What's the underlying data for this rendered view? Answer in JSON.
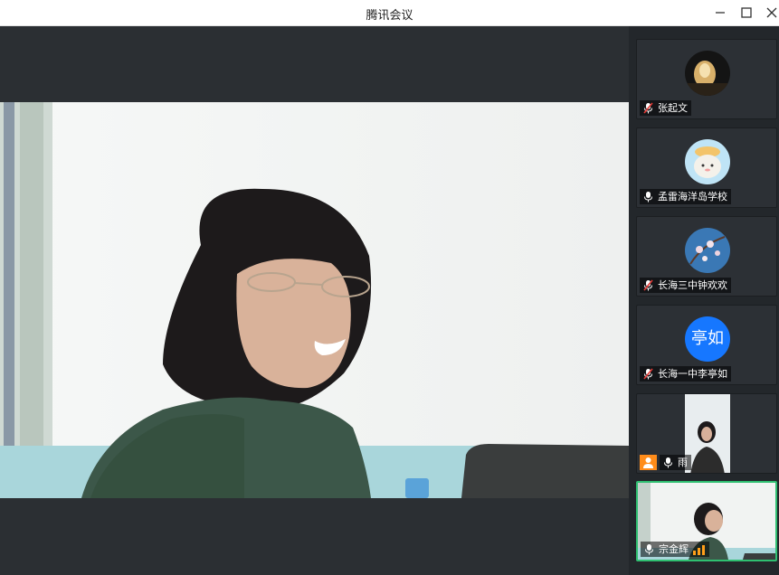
{
  "window": {
    "title": "腾讯会议"
  },
  "controls": {
    "minimize_icon": "minimize-icon",
    "maximize_icon": "maximize-icon",
    "close_icon": "close-icon"
  },
  "participants": [
    {
      "name": "张起文",
      "mic": "muted",
      "avatar": "image"
    },
    {
      "name": "孟雷海洋岛学校",
      "mic": "on",
      "avatar": "image"
    },
    {
      "name": "长海三中钟欢欢",
      "mic": "muted",
      "avatar": "image"
    },
    {
      "name": "长海一中李亭如",
      "mic": "muted",
      "avatar": "text",
      "avatar_text": "亭如"
    },
    {
      "name": "雨",
      "mic": "on",
      "avatar": "video",
      "sharing": true
    },
    {
      "name": "宗金辉",
      "mic": "on",
      "avatar": "video",
      "speaking": true
    }
  ],
  "colors": {
    "accent": "#1677ff",
    "active_border": "#2fbf71",
    "share_badge": "#ff8c1a",
    "muted_mic": "#e53935"
  }
}
